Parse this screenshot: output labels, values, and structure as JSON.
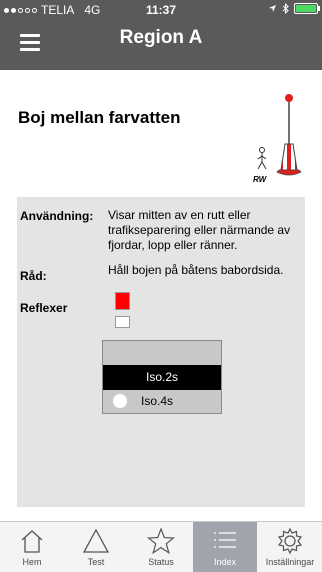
{
  "status_bar": {
    "carrier": "TELIA",
    "network": "4G",
    "time": "11:37"
  },
  "header": {
    "title": "Region A"
  },
  "page": {
    "title": "Boj mellan farvatten",
    "buoy_code": "RW"
  },
  "details": {
    "usage_label": "Användning:",
    "usage_text": [
      "Visar mitten av en rutt eller",
      "trafikseparering eller närmande av",
      "fjordar, lopp eller ränner."
    ],
    "advice_label": "Råd:",
    "advice_text": "Håll bojen på båtens babordsida.",
    "reflectors_label": "Reflexer",
    "reflector_colors": [
      "#ff0000",
      "#ffffff"
    ]
  },
  "light": {
    "day_label": "Iso.2s",
    "night_label": "Iso.4s"
  },
  "tabs": [
    {
      "label": "Hem",
      "icon": "house-icon"
    },
    {
      "label": "Test",
      "icon": "triangle-icon"
    },
    {
      "label": "Status",
      "icon": "star-icon"
    },
    {
      "label": "Index",
      "icon": "list-icon",
      "active": true
    },
    {
      "label": "Inställningar",
      "icon": "gear-icon"
    }
  ],
  "colors": {
    "bar_gray": "#5a5a5a",
    "panel_gray": "#e4e4e4",
    "buoy_red": "#e02020",
    "battery_green": "#4cd964",
    "active_tab": "#9fa4ad"
  }
}
